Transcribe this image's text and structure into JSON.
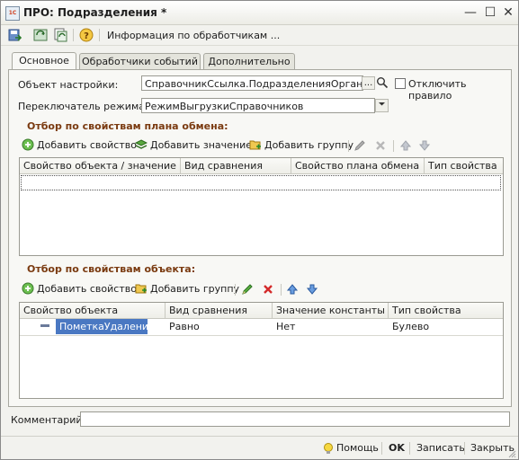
{
  "window": {
    "title": "ПРО: Подразделения *",
    "app_icon_text": "1C",
    "minimize": "—",
    "maximize": "☐",
    "close": "✕"
  },
  "toolbar": {
    "handlers_info_label": "Информация по обработчикам ..."
  },
  "tabs": [
    "Основное",
    "Обработчики событий",
    "Дополнительно"
  ],
  "form": {
    "object_label": "Объект настройки:",
    "object_value": "СправочникСсылка.ПодразделенияОрганизаций",
    "object_btn": "...",
    "disable_rule_label": "Отключить правило",
    "mode_label": "Переключатель режима:",
    "mode_value": "РежимВыгрузкиСправочников"
  },
  "exchange_filter": {
    "title": "Отбор по свойствам плана обмена:",
    "add_property": "Добавить свойство",
    "add_value": "Добавить значение",
    "add_group": "Добавить группу",
    "columns": [
      "Свойство объекта / значение ко...",
      "Вид сравнения",
      "Свойство плана обмена",
      "Тип свойства"
    ]
  },
  "object_filter": {
    "title": "Отбор по свойствам объекта:",
    "add_property": "Добавить свойство",
    "add_group": "Добавить группу",
    "columns": [
      "Свойство объекта",
      "Вид сравнения",
      "Значение константы",
      "Тип свойства"
    ],
    "rows": [
      {
        "property": "ПометкаУдаления",
        "comparison": "Равно",
        "value": "Нет",
        "type": "Булево"
      }
    ]
  },
  "comment": {
    "label": "Комментарий:",
    "value": ""
  },
  "statusbar": {
    "help": "Помощь",
    "ok": "OK",
    "save": "Записать",
    "close": "Закрыть"
  }
}
